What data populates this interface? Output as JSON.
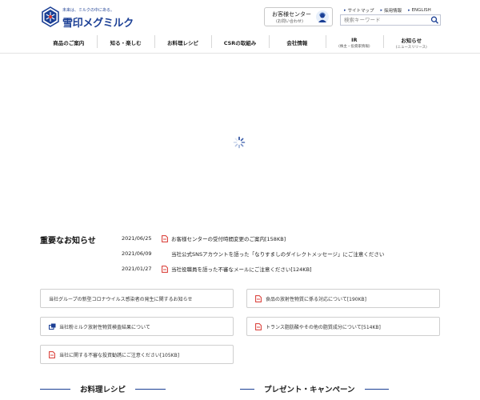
{
  "header": {
    "logo_tagline": "未来は、ミルクの中にある。",
    "logo_text": "雪印メグミルク",
    "support_title": "お客様センター",
    "support_sub": "(お問い合わせ)",
    "top_links": [
      "サイトマップ",
      "採用情報",
      "ENGLISH"
    ],
    "search": {
      "placeholder": "検索キーワード"
    }
  },
  "nav": [
    {
      "label": "商品のご案内",
      "sub": ""
    },
    {
      "label": "知る・楽しむ",
      "sub": ""
    },
    {
      "label": "お料理レシピ",
      "sub": ""
    },
    {
      "label": "CSRの取組み",
      "sub": ""
    },
    {
      "label": "会社情報",
      "sub": ""
    },
    {
      "label": "IR",
      "sub": "(株主・投資家情報)"
    },
    {
      "label": "お知らせ",
      "sub": "(ニュースリリース)"
    }
  ],
  "news": {
    "heading": "重要なお知らせ",
    "items": [
      {
        "date": "2021/06/25",
        "icon": "pdf-icon",
        "title": "お客様センターの受付時間変更のご案内[158KB]"
      },
      {
        "date": "2021/06/09",
        "icon": "",
        "title": "当社公式SNSアカウントを語った「なりすましのダイレクトメッセージ」にご注意ください"
      },
      {
        "date": "2021/01/27",
        "icon": "pdf-icon",
        "title": "当社役職員を語った不審なメールにご注意ください[124KB]"
      }
    ]
  },
  "link_boxes": [
    {
      "icon": "",
      "label": "当社グループの新型コロナウイルス感染者の発生に関するお知らせ"
    },
    {
      "icon": "pdf-icon",
      "label": "食品の放射性物質に係る対応について[190KB]"
    },
    {
      "icon": "window-icon",
      "label": "当社粉ミルク放射性物質検査結果について"
    },
    {
      "icon": "pdf-icon",
      "label": "トランス脂肪酸やその他の脂質成分について[514KB]"
    },
    {
      "icon": "pdf-icon",
      "label": "当社に関する不審な投資勧誘にご注意ください[105KB]"
    }
  ],
  "sections": {
    "recipe": "お料理レシピ",
    "campaign": "プレゼント・キャンペーン"
  },
  "colors": {
    "brand_blue": "#1b3f95",
    "pdf_red": "#d8322b"
  }
}
